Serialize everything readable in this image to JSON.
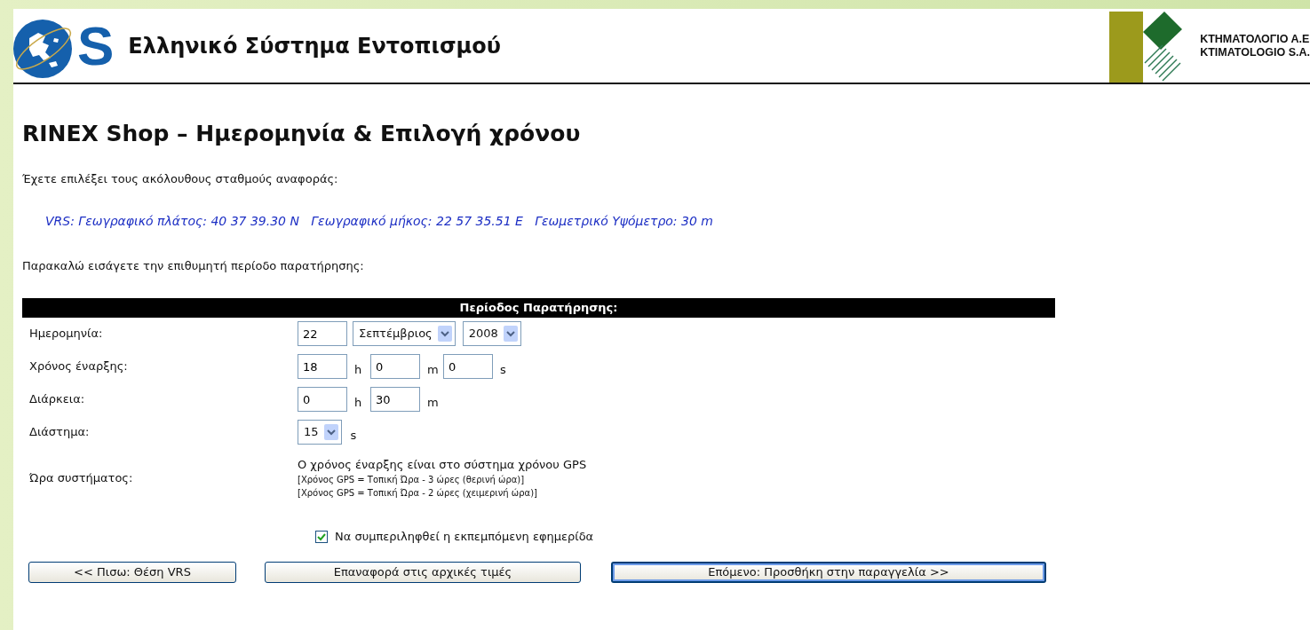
{
  "header": {
    "logo_letter": "S",
    "title": "Ελληνικό Σύστημα Εντοπισμού",
    "partner_lines": [
      "ΚΤΗΜΑΤΟΛΟΓΙΟ Α.Ε",
      "KTIMATOLOGIO S.A."
    ]
  },
  "heading": "RINEX Shop – Ημερομηνία & Επιλογή χρόνου",
  "intro": "Έχετε επιλέξει τους ακόλουθους σταθμούς αναφοράς:",
  "station": "VRS: Γεωγραφικό πλάτος: 40 37 39.30 N   Γεωγραφικό μήκος: 22 57 35.51 E   Γεωμετρικό Υψόμετρο: 30 m",
  "prompt": "Παρακαλώ εισάγετε την επιθυμητή περίοδο παρατήρησης:",
  "form": {
    "title": "Περίοδος Παρατήρησης:",
    "rows": [
      {
        "kind": "fields",
        "label": "Ημερομηνία:",
        "controls": [
          {
            "kind": "input",
            "value": "22"
          },
          {
            "kind": "select",
            "value": "Σεπτέμβριος"
          },
          {
            "kind": "select",
            "value": "2008"
          }
        ]
      },
      {
        "kind": "fields",
        "label": "Χρόνος έναρξης:",
        "controls": [
          {
            "kind": "input",
            "value": "18"
          },
          {
            "kind": "unit",
            "value": "h"
          },
          {
            "kind": "input",
            "value": "0"
          },
          {
            "kind": "unit",
            "value": "m"
          },
          {
            "kind": "input",
            "value": "0"
          },
          {
            "kind": "unit",
            "value": "s"
          }
        ]
      },
      {
        "kind": "fields",
        "label": "Διάρκεια:",
        "controls": [
          {
            "kind": "input",
            "value": "0"
          },
          {
            "kind": "unit",
            "value": "h"
          },
          {
            "kind": "input",
            "value": "30"
          },
          {
            "kind": "unit",
            "value": "m"
          }
        ]
      },
      {
        "kind": "fields",
        "label": "Διάστημα:",
        "controls": [
          {
            "kind": "select",
            "value": "15"
          },
          {
            "kind": "unit",
            "value": "s"
          }
        ]
      },
      {
        "kind": "note",
        "label": "Ώρα συστήματος:",
        "lines": [
          "Ο χρόνος έναρξης είναι στο σύστημα χρόνου GPS",
          "[Χρόνος GPS = Τοπική Ώρα - 3 ώρες (θερινή ώρα)]",
          "[Χρόνος GPS = Τοπική Ώρα - 2 ώρες (χειμερινή ώρα)]"
        ]
      }
    ]
  },
  "checkbox": {
    "label": "Να συμπεριληφθεί η εκπεμπόμενη εφημερίδα",
    "checked": true
  },
  "buttons": [
    {
      "label": "<< Πισω: Θέση VRS",
      "default": false
    },
    {
      "label": "Επαναφορά στις αρχικές τιμές",
      "default": false
    },
    {
      "label": "Επόμενο: Προσθήκη στην παραγγελία >>",
      "default": true
    }
  ]
}
